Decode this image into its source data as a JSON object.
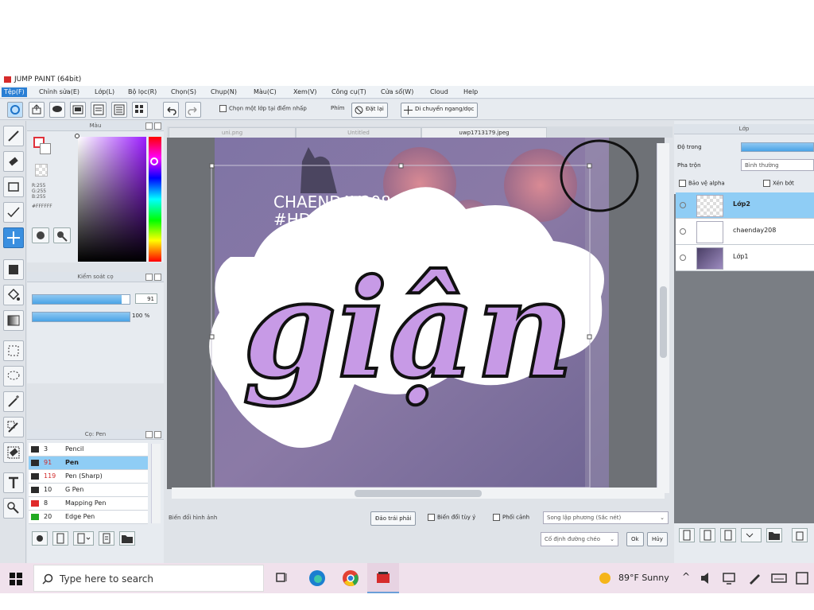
{
  "window": {
    "title": "JUMP PAINT (64bit)"
  },
  "menus": [
    "Tệp(F)",
    "Chỉnh sửa(E)",
    "Lớp(L)",
    "Bộ lọc(R)",
    "Chọn(S)",
    "Chụp(N)",
    "Màu(C)",
    "Xem(V)",
    "Công cụ(T)",
    "Cửa sổ(W)",
    "Cloud",
    "Help"
  ],
  "toolbar": {
    "layer_pick_label": "Chọn một lớp tại điểm nhấp",
    "key_label": "Phím",
    "reset_label": "Đặt lại",
    "move_label": "Di chuyển ngang/dọc"
  },
  "color_panel": {
    "title": "Màu",
    "rgb": [
      "R:255",
      "G:255",
      "B:255"
    ],
    "hex": "#FFFFFF"
  },
  "brush_panel": {
    "title": "Kiểm soát cọ",
    "size_value": "91",
    "opacity_value": "100 %",
    "size_fraction": 0.92,
    "opacity_fraction": 1.0
  },
  "pen_panel": {
    "title": "Cọ: Pen",
    "items": [
      {
        "size": "3",
        "name": "Pencil",
        "color": "#2b2b2b",
        "red_size": false,
        "selected": false
      },
      {
        "size": "91",
        "name": "Pen",
        "color": "#2b2b2b",
        "red_size": true,
        "selected": true
      },
      {
        "size": "119",
        "name": "Pen (Sharp)",
        "color": "#2b2b2b",
        "red_size": true,
        "selected": false
      },
      {
        "size": "10",
        "name": "G Pen",
        "color": "#2b2b2b",
        "red_size": false,
        "selected": false
      },
      {
        "size": "8",
        "name": "Mapping Pen",
        "color": "#e02a2a",
        "red_size": false,
        "selected": false
      },
      {
        "size": "20",
        "name": "Edge Pen",
        "color": "#22aa22",
        "red_size": false,
        "selected": false
      }
    ]
  },
  "tabs": [
    {
      "label": "uni.png",
      "active": false
    },
    {
      "label": "Untitled",
      "active": false
    },
    {
      "label": "uwp1713179.jpeg",
      "active": true
    }
  ],
  "artwork": {
    "line1": "CHAENDAY208",
    "line2": "#HD247",
    "word": "giận"
  },
  "canvas_bar": {
    "transform_label": "Biến đổi hình ảnh",
    "flip_button": "Đảo trái phải",
    "free_transform": "Biến đổi tùy ý",
    "perspective": "Phối cảnh",
    "interp_option": "Song lập phương (Sắc nét)",
    "fix_option": "Cố định đường chéo",
    "ok_button": "Ok",
    "cancel_button": "Hủy"
  },
  "layer_panel": {
    "title": "Lớp",
    "opacity_label": "Độ trong",
    "blend_label": "Pha trộn",
    "blend_value": "Bình thường",
    "protect_alpha": "Bảo vệ alpha",
    "clipping": "Xén bớt",
    "layers": [
      {
        "name": "Lớp2",
        "selected": true
      },
      {
        "name": "chaenday208",
        "selected": false
      },
      {
        "name": "Lớp1",
        "selected": false
      }
    ]
  },
  "taskbar": {
    "search_placeholder": "Type here to search",
    "weather": "89°F Sunny"
  }
}
